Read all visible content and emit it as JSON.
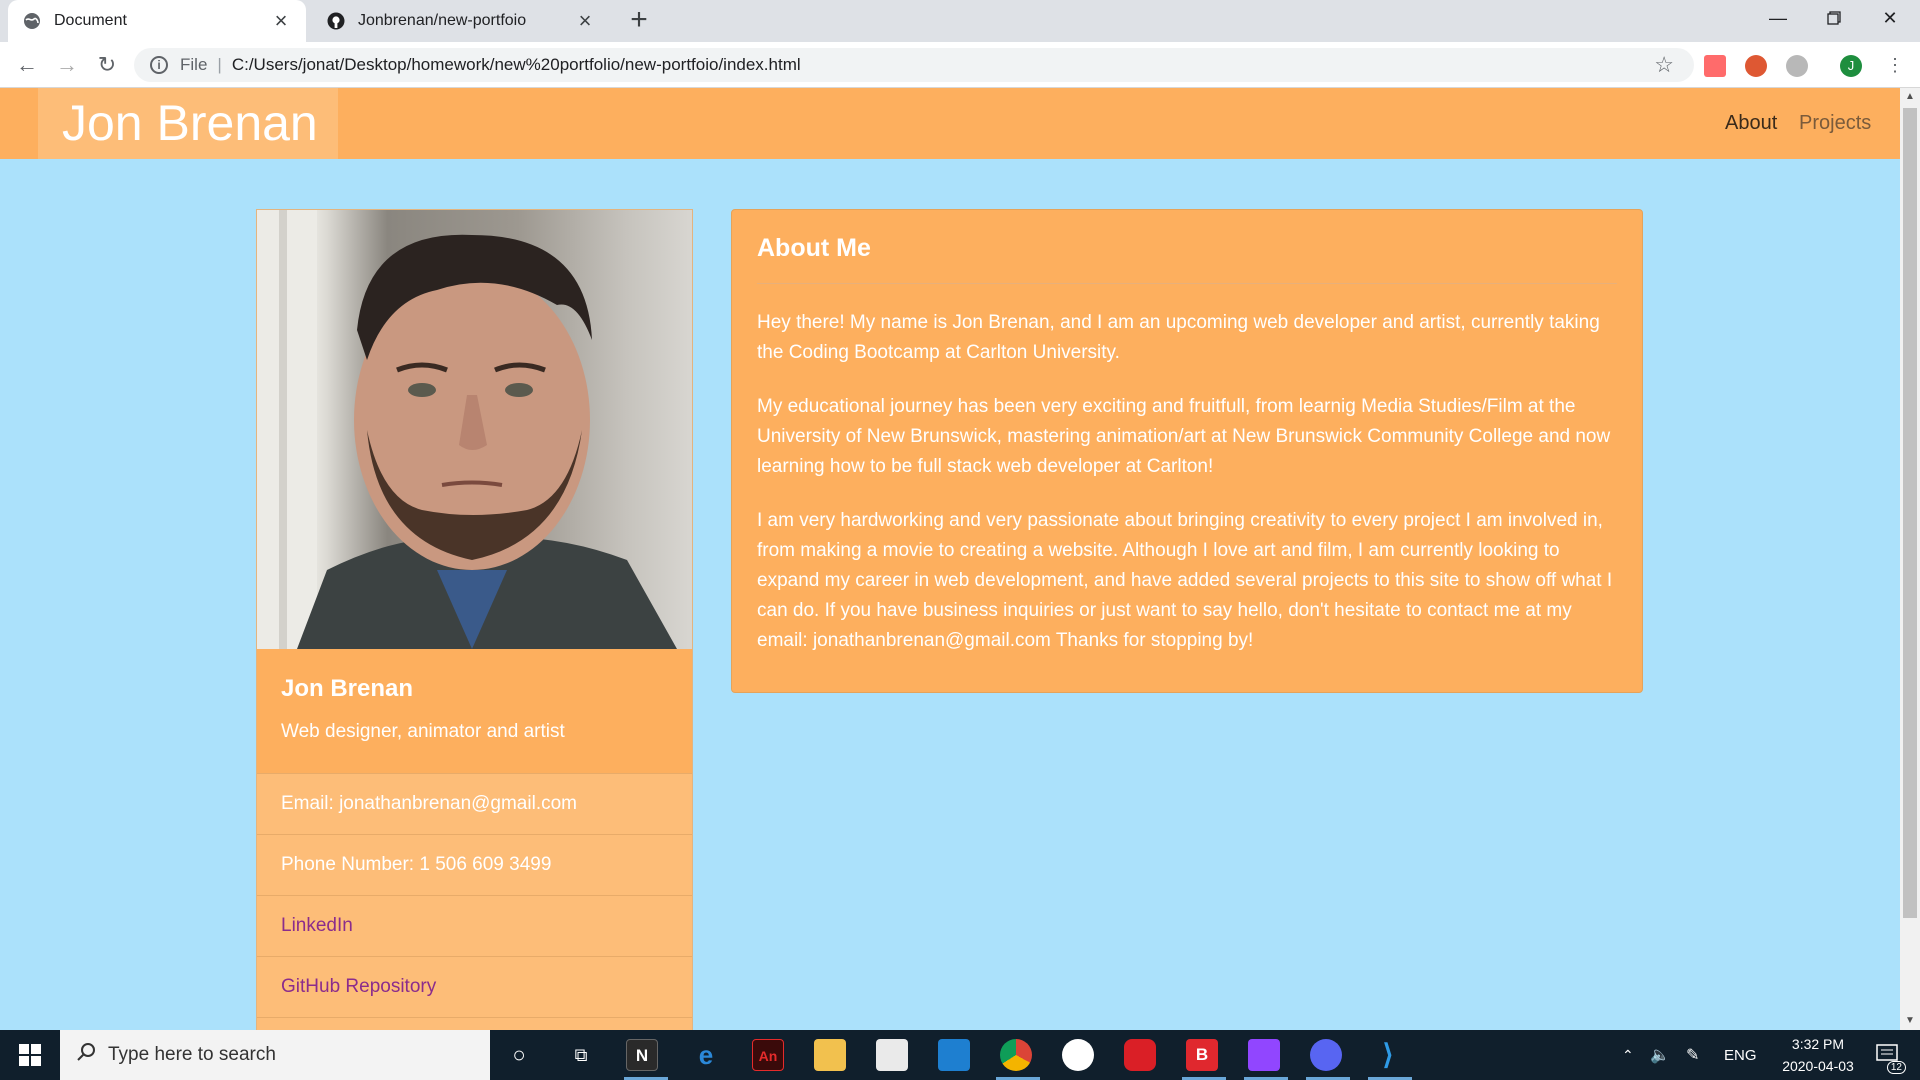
{
  "browser": {
    "tabs": [
      {
        "title": "Document",
        "favicon": "globe-icon",
        "active": true
      },
      {
        "title": "Jonbrenan/new-portfoio",
        "favicon": "github-icon",
        "active": false
      }
    ],
    "new_tab_label": "+",
    "address": {
      "scheme_label": "File",
      "url": "C:/Users/jonat/Desktop/homework/new%20portfolio/new-portfoio/index.html"
    },
    "profile_initial": "J"
  },
  "site": {
    "brand": "Jon Brenan",
    "nav": [
      {
        "label": "About",
        "active": true
      },
      {
        "label": "Projects",
        "active": false
      }
    ],
    "profile": {
      "name": "Jon Brenan",
      "tagline": "Web designer, animator and artist",
      "email": "Email: jonathanbrenan@gmail.com",
      "phone": "Phone Number: 1 506 609 3499",
      "linkedin": "LinkedIn",
      "github": "GitHub Repository"
    },
    "about": {
      "heading": "About Me",
      "paragraphs": [
        "Hey there! My name is Jon Brenan, and I am an upcoming web developer and artist, currently taking the Coding Bootcamp at Carlton University.",
        "My educational journey has been very exciting and fruitfull, from learnig Media Studies/Film at the University of New Brunswick, mastering animation/art at New Brunswick Community College and now learning how to be full stack web developer at Carlton!",
        "I am very hardworking and very passionate about bringing creativity to every project I am involved in, from making a movie to creating a website. Although I love art and film, I am currently looking to expand my career in web development, and have added several projects to this site to show off what I can do. If you have business inquiries or just want to say hello, don't hesitate to contact me at my email: jonathanbrenan@gmail.com Thanks for stopping by!"
      ]
    }
  },
  "taskbar": {
    "search_placeholder": "Type here to search",
    "language": "ENG",
    "time": "3:32 PM",
    "date": "2020-04-03",
    "notification_count": "12"
  },
  "colors": {
    "page_bg": "#abe1fb",
    "accent_orange": "#fdaf5e",
    "light_orange": "#fdbd78",
    "link_purple": "#8b2c8c"
  }
}
